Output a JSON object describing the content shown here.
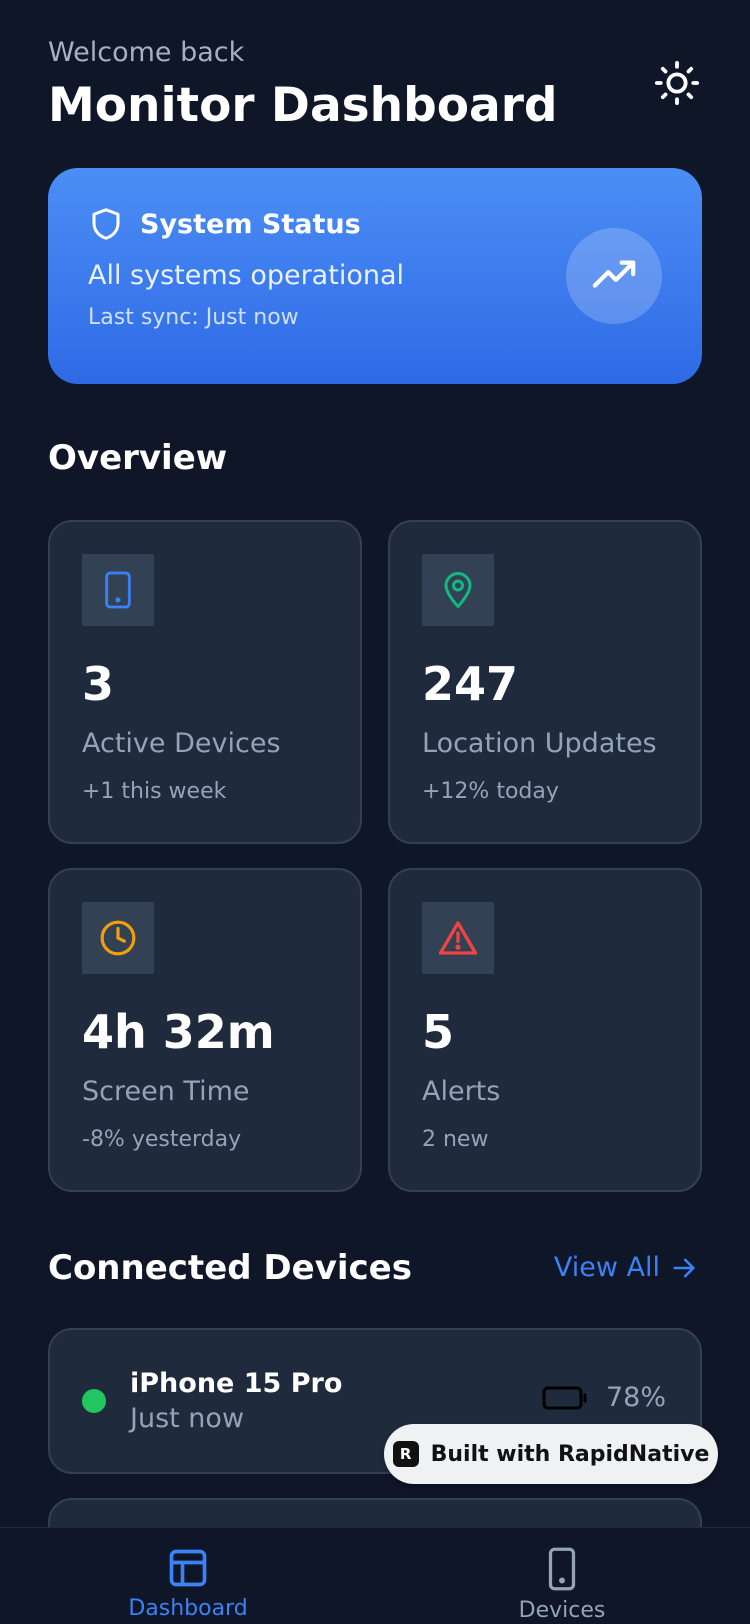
{
  "header": {
    "welcome": "Welcome back",
    "title": "Monitor Dashboard"
  },
  "status": {
    "title": "System Status",
    "message": "All systems operational",
    "sync": "Last sync: Just now"
  },
  "overview": {
    "title": "Overview",
    "stats": [
      {
        "value": "3",
        "label": "Active Devices",
        "delta": "+1 this week",
        "icon": "phone-icon",
        "color": "#3b82f6"
      },
      {
        "value": "247",
        "label": "Location Updates",
        "delta": "+12% today",
        "icon": "map-pin-icon",
        "color": "#10b981"
      },
      {
        "value": "4h 32m",
        "label": "Screen Time",
        "delta": "-8% yesterday",
        "icon": "clock-icon",
        "color": "#f59e0b"
      },
      {
        "value": "5",
        "label": "Alerts",
        "delta": "2 new",
        "icon": "alert-triangle-icon",
        "color": "#ef4444"
      }
    ]
  },
  "devices": {
    "title": "Connected Devices",
    "view_all": "View All",
    "items": [
      {
        "name": "iPhone 15 Pro",
        "last_seen": "Just now",
        "battery": "78%",
        "status_color": "#22c55e"
      }
    ]
  },
  "badge": {
    "text": "Built with RapidNative"
  },
  "tabs": [
    {
      "label": "Dashboard"
    },
    {
      "label": "Devices"
    }
  ]
}
